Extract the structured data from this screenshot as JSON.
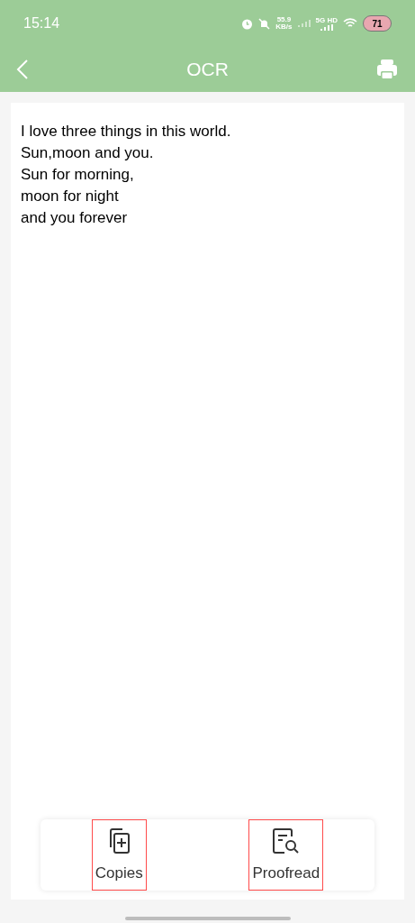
{
  "status_bar": {
    "time": "15:14",
    "speed": "55.9",
    "speed_unit": "KB/s",
    "network": "5G HD",
    "battery": "71"
  },
  "header": {
    "title": "OCR"
  },
  "text_lines": [
    "I love three things in this world.",
    "Sun,moon and you.",
    "Sun for morning,",
    "moon for night",
    "and you forever"
  ],
  "actions": [
    {
      "kind": "copies",
      "label": "Copies",
      "highlighted": true
    },
    {
      "kind": "proofread",
      "label": "Proofread",
      "highlighted": true
    }
  ]
}
